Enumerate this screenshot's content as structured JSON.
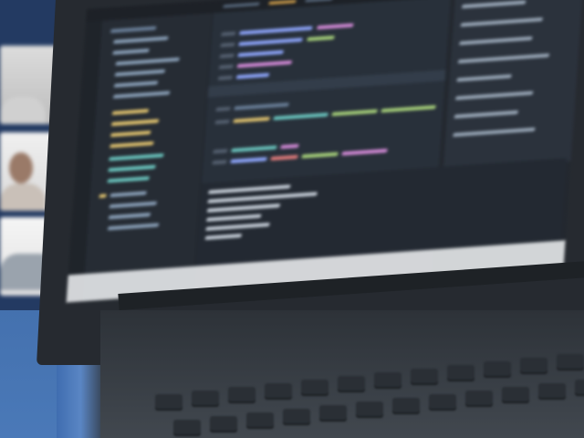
{
  "scene": {
    "call_participants": 3,
    "editor_colors": {
      "background": "#23282f",
      "sidebar": "#262c34",
      "keyword": "#8fa7ff",
      "string": "#a7d17a",
      "function": "#d48ad8",
      "type": "#e0c26e",
      "comment": "#6a7f99"
    }
  }
}
